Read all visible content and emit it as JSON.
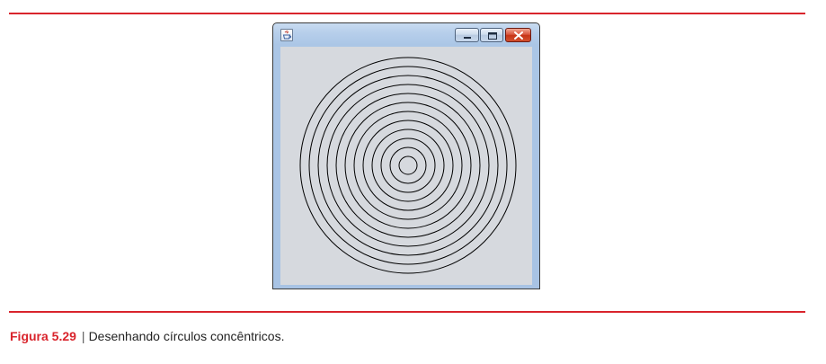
{
  "window": {
    "title": "",
    "controls": {
      "minimize": "minimize-icon",
      "maximize": "maximize-icon",
      "close": "close-icon"
    },
    "client_background": "#d6d9de"
  },
  "drawing": {
    "shape": "circle",
    "circle_count": 12,
    "stroke_color": "#000000"
  },
  "caption": {
    "figure_label": "Figura 5.29",
    "separator": "|",
    "text": "Desenhando círculos concêntricos."
  },
  "colors": {
    "accent": "#d9242c",
    "title_bar": "#abc6e6",
    "close_button": "#c63517"
  }
}
